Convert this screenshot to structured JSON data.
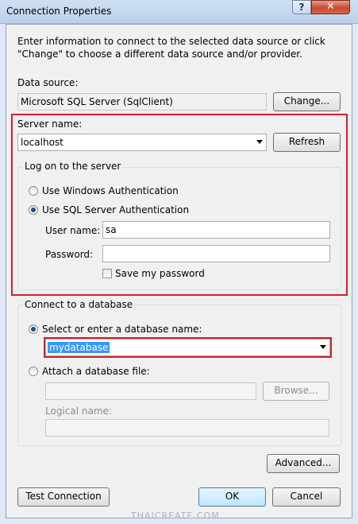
{
  "window": {
    "title": "Connection Properties",
    "help_label": "?",
    "close_label": "✕"
  },
  "intro": "Enter information to connect to the selected data source or click \"Change\" to choose a different data source and/or provider.",
  "data_source": {
    "label": "Data source:",
    "value": "Microsoft SQL Server (SqlClient)",
    "change_label": "Change..."
  },
  "server": {
    "label": "Server name:",
    "value": "localhost",
    "refresh_label": "Refresh"
  },
  "logon": {
    "group_label": "Log on to the server",
    "windows_auth_label": "Use Windows Authentication",
    "sql_auth_label": "Use SQL Server Authentication",
    "selected": "sql",
    "username_label": "User name:",
    "username_value": "sa",
    "password_label": "Password:",
    "password_value": "",
    "save_password_label": "Save my password",
    "save_password_checked": false
  },
  "database": {
    "group_label": "Connect to a database",
    "select_label": "Select or enter a database name:",
    "db_name": "mydatabase",
    "attach_label": "Attach a database file:",
    "attach_value": "",
    "browse_label": "Browse...",
    "logical_label": "Logical name:",
    "logical_value": ""
  },
  "buttons": {
    "advanced": "Advanced...",
    "test": "Test Connection",
    "ok": "OK",
    "cancel": "Cancel"
  },
  "watermark": "THAICREATE.COM",
  "colors": {
    "highlight_border": "#d61f26",
    "selection": "#3399ff"
  }
}
